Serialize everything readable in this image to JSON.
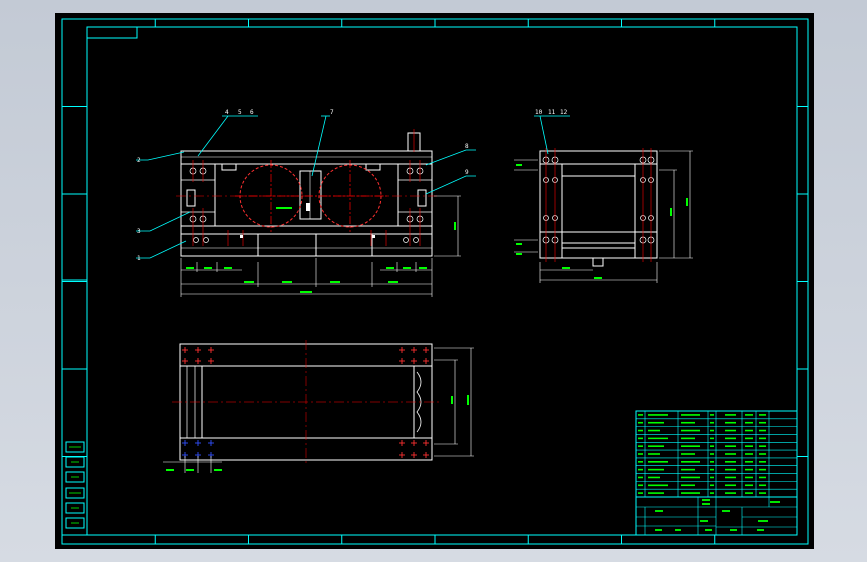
{
  "drawing": {
    "balloons": {
      "b1": "1",
      "b2": "2",
      "b3": "3",
      "b4": "4",
      "b5": "5",
      "b6": "6",
      "b7": "7",
      "b8": "8",
      "b9": "9",
      "b10": "10",
      "b11": "11",
      "b12": "12"
    },
    "colors": {
      "background": "#000000",
      "outline": "#ffffff",
      "leaders": "#00ffff",
      "centerlines": "#ff0000",
      "dimensions": "#00ff00",
      "hidden": "#ff3030",
      "blue_marks": "#3050ff"
    }
  }
}
